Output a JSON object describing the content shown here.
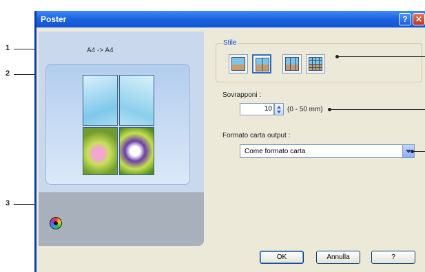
{
  "window": {
    "title": "Poster",
    "help_glyph": "?",
    "close_glyph": "✕"
  },
  "callouts": {
    "c1": "1",
    "c2": "2",
    "c3": "3"
  },
  "preview": {
    "size_label": "A4 -> A4"
  },
  "stile": {
    "label": "Stile",
    "styles": [
      "style-1x1",
      "style-2x2",
      "style-3x3",
      "style-4x4"
    ],
    "selected_index": 1
  },
  "overlap": {
    "label": "Sovrapponi :",
    "value": "10",
    "range": "(0 - 50 mm)"
  },
  "paper_format": {
    "label": "Formato carta output :",
    "value": "Come formato carta"
  },
  "buttons": {
    "ok": "OK",
    "cancel": "Annulla",
    "help": "?"
  },
  "colors": {
    "title_bar": "#1e64e0",
    "window_bg": "#ece9d8",
    "accent": "#0046d5"
  }
}
